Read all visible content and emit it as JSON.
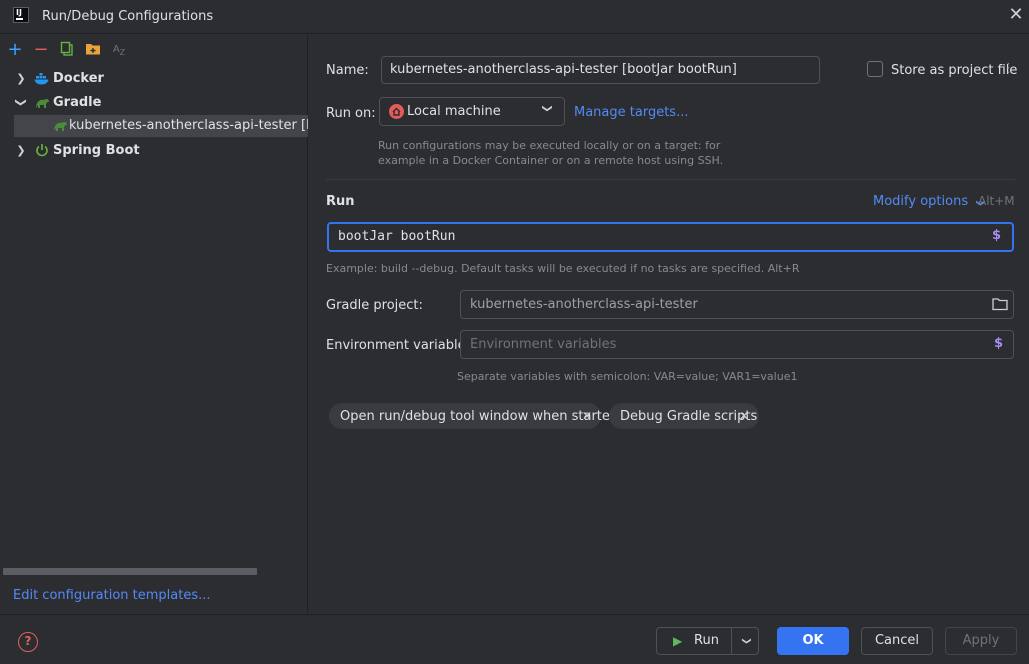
{
  "window": {
    "title": "Run/Debug Configurations",
    "app_icon": "intellij-icon"
  },
  "sidebar": {
    "toolbar": [
      "add-icon",
      "remove-icon",
      "copy-icon",
      "new-folder-icon",
      "sort-az-icon"
    ],
    "tree": [
      {
        "label": "Docker",
        "icon": "docker-icon",
        "expanded": false
      },
      {
        "label": "Gradle",
        "icon": "gradle-icon",
        "expanded": true
      },
      {
        "label": "kubernetes-anotherclass-api-tester [bootJar b",
        "icon": "gradle-icon",
        "selected": true
      },
      {
        "label": "Spring Boot",
        "icon": "spring-boot-icon",
        "expanded": false
      }
    ],
    "edit_templates": "Edit configuration templates..."
  },
  "form": {
    "name_label": "Name:",
    "name_value": "kubernetes-anotherclass-api-tester [bootJar bootRun]",
    "store_label": "Store as project file",
    "store_checked": false,
    "run_on_label": "Run on:",
    "run_on_value": "Local machine",
    "manage_targets": "Manage targets...",
    "run_on_hint_1": "Run configurations may be executed locally or on a target: for",
    "run_on_hint_2": "example in a Docker Container or on a remote host using SSH.",
    "run_section": "Run",
    "modify_options": "Modify options",
    "modify_shortcut": "Alt+M",
    "tasks_value": "bootJar bootRun",
    "tasks_hint": "Example: build --debug. Default tasks will be executed if no tasks are specified. Alt+R",
    "gradle_project_label": "Gradle project:",
    "gradle_project_value": "kubernetes-anotherclass-api-tester",
    "env_label": "Environment variables:",
    "env_placeholder": "Environment variables",
    "env_hint": "Separate variables with semicolon: VAR=value; VAR1=value1",
    "chips": [
      "Open run/debug tool window when started",
      "Debug Gradle scripts"
    ]
  },
  "buttons": {
    "run": "Run",
    "ok": "OK",
    "cancel": "Cancel",
    "apply": "Apply"
  },
  "colors": {
    "accent": "#3574f0",
    "link": "#548af7",
    "dollar": "#a88cf2",
    "gradle": "#4c8b3a",
    "docker": "#2396ed",
    "spring": "#6db33f"
  }
}
